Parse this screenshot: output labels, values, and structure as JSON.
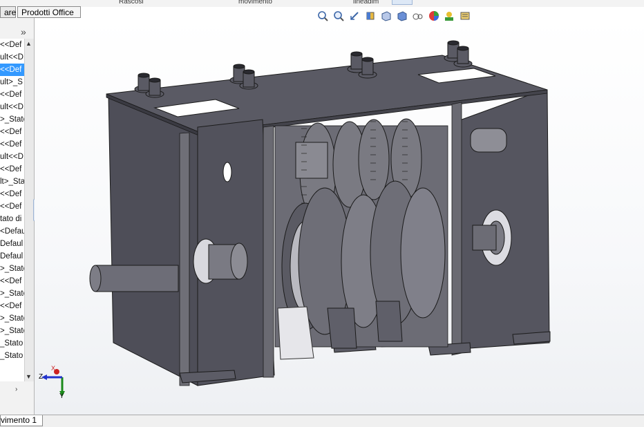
{
  "tabs": [
    {
      "label": "are"
    },
    {
      "label": "Prodotti Office"
    }
  ],
  "top_cut_labels": [
    "Rascosi",
    "movimento",
    "lineadim"
  ],
  "tree": {
    "items": [
      {
        "label": "<<Def"
      },
      {
        "label": "ult<<D"
      },
      {
        "label": "<<Def",
        "selected": true
      },
      {
        "label": "ult>_S"
      },
      {
        "label": "<<Def"
      },
      {
        "label": "ult<<D"
      },
      {
        "label": ">_Stato"
      },
      {
        "label": "<<Def"
      },
      {
        "label": "<<Def"
      },
      {
        "label": "ult<<D"
      },
      {
        "label": "<<Def"
      },
      {
        "label": "lt>_Sta"
      },
      {
        "label": "<<Def"
      },
      {
        "label": "<<Def"
      },
      {
        "label": "tato di"
      },
      {
        "label": "<Defau"
      },
      {
        "label": "Defaul"
      },
      {
        "label": "Defaul"
      },
      {
        "label": ">_Stato"
      },
      {
        "label": "<<Def"
      },
      {
        "label": ">_Stato"
      },
      {
        "label": "<<Def"
      },
      {
        "label": ">_Stato"
      },
      {
        "label": ">_Stato"
      },
      {
        "label": "_Stato"
      },
      {
        "label": "_Stato"
      }
    ]
  },
  "bottom_tab": {
    "label": "vimento 1"
  },
  "triad": {
    "x": "X",
    "y": "Y",
    "z": "Z"
  },
  "viewport_toolbar": [
    "zoom-to-fit-icon",
    "zoom-area-icon",
    "previous-view-icon",
    "section-view-icon",
    "view-orientation-icon",
    "display-style-icon",
    "hide-show-icon",
    "edit-appearance-icon",
    "apply-scene-icon",
    "view-settings-icon"
  ],
  "colors": {
    "accent": "#3399ff",
    "model": "#5e5e68"
  }
}
